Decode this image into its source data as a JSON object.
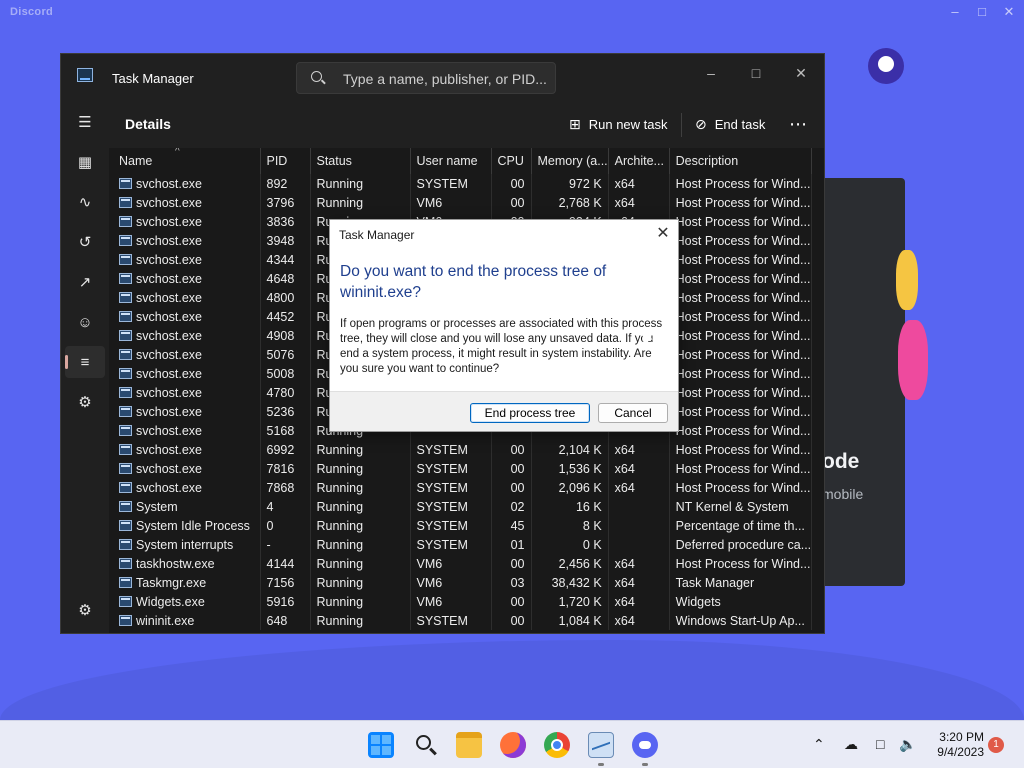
{
  "discord": {
    "title": "Discord",
    "card_title": "ode",
    "card_subtitle": "mobile"
  },
  "task_manager": {
    "title": "Task Manager",
    "search_placeholder": "Type a name, publisher, or PID...",
    "page_title": "Details",
    "run_new_task": "Run new task",
    "end_task": "End task",
    "more": "⋯",
    "sidebar": [
      {
        "name": "hamburger-menu-icon",
        "glyph": "☰"
      },
      {
        "name": "processes-icon",
        "glyph": "▦"
      },
      {
        "name": "performance-icon",
        "glyph": "∿"
      },
      {
        "name": "app-history-icon",
        "glyph": "↺"
      },
      {
        "name": "startup-apps-icon",
        "glyph": "↗"
      },
      {
        "name": "users-icon",
        "glyph": "☺"
      },
      {
        "name": "details-icon",
        "glyph": "≡"
      },
      {
        "name": "services-icon",
        "glyph": "⚙"
      }
    ],
    "settings_glyph": "⚙",
    "columns": [
      "Name",
      "PID",
      "Status",
      "User name",
      "CPU",
      "Memory (a...",
      "Archite...",
      "Description"
    ],
    "rows": [
      [
        "svchost.exe",
        "892",
        "Running",
        "SYSTEM",
        "00",
        "972 K",
        "x64",
        "Host Process for Wind..."
      ],
      [
        "svchost.exe",
        "3796",
        "Running",
        "VM6",
        "00",
        "2,768 K",
        "x64",
        "Host Process for Wind..."
      ],
      [
        "svchost.exe",
        "3836",
        "Running",
        "VM6",
        "00",
        "924 K",
        "x64",
        "Host Process for Wind..."
      ],
      [
        "svchost.exe",
        "3948",
        "Running",
        "",
        "",
        "",
        "",
        "Host Process for Wind..."
      ],
      [
        "svchost.exe",
        "4344",
        "Running",
        "",
        "",
        "",
        "",
        "Host Process for Wind..."
      ],
      [
        "svchost.exe",
        "4648",
        "Running",
        "",
        "",
        "",
        "",
        "Host Process for Wind..."
      ],
      [
        "svchost.exe",
        "4800",
        "Running",
        "",
        "",
        "",
        "",
        "Host Process for Wind..."
      ],
      [
        "svchost.exe",
        "4452",
        "Running",
        "",
        "",
        "",
        "",
        "Host Process for Wind..."
      ],
      [
        "svchost.exe",
        "4908",
        "Running",
        "",
        "",
        "",
        "",
        "Host Process for Wind..."
      ],
      [
        "svchost.exe",
        "5076",
        "Running",
        "",
        "",
        "",
        "",
        "Host Process for Wind..."
      ],
      [
        "svchost.exe",
        "5008",
        "Running",
        "",
        "",
        "",
        "",
        "Host Process for Wind..."
      ],
      [
        "svchost.exe",
        "4780",
        "Running",
        "",
        "",
        "",
        "",
        "Host Process for Wind..."
      ],
      [
        "svchost.exe",
        "5236",
        "Running",
        "",
        "",
        "",
        "",
        "Host Process for Wind..."
      ],
      [
        "svchost.exe",
        "5168",
        "Running",
        "",
        "",
        "",
        "",
        "Host Process for Wind..."
      ],
      [
        "svchost.exe",
        "6992",
        "Running",
        "SYSTEM",
        "00",
        "2,104 K",
        "x64",
        "Host Process for Wind..."
      ],
      [
        "svchost.exe",
        "7816",
        "Running",
        "SYSTEM",
        "00",
        "1,536 K",
        "x64",
        "Host Process for Wind..."
      ],
      [
        "svchost.exe",
        "7868",
        "Running",
        "SYSTEM",
        "00",
        "2,096 K",
        "x64",
        "Host Process for Wind..."
      ],
      [
        "System",
        "4",
        "Running",
        "SYSTEM",
        "02",
        "16 K",
        "",
        "NT Kernel & System"
      ],
      [
        "System Idle Process",
        "0",
        "Running",
        "SYSTEM",
        "45",
        "8 K",
        "",
        "Percentage of time th..."
      ],
      [
        "System interrupts",
        "-",
        "Running",
        "SYSTEM",
        "01",
        "0 K",
        "",
        "Deferred procedure ca..."
      ],
      [
        "taskhostw.exe",
        "4144",
        "Running",
        "VM6",
        "00",
        "2,456 K",
        "x64",
        "Host Process for Wind..."
      ],
      [
        "Taskmgr.exe",
        "7156",
        "Running",
        "VM6",
        "03",
        "38,432 K",
        "x64",
        "Task Manager"
      ],
      [
        "Widgets.exe",
        "5916",
        "Running",
        "VM6",
        "00",
        "1,720 K",
        "x64",
        "Widgets"
      ],
      [
        "wininit.exe",
        "648",
        "Running",
        "SYSTEM",
        "00",
        "1,084 K",
        "x64",
        "Windows Start-Up Ap..."
      ]
    ]
  },
  "dialog": {
    "title": "Task Manager",
    "heading": "Do you want to end the process tree of wininit.exe?",
    "body": "If open programs or processes are associated with this process tree, they will close and you will lose any unsaved data. If you end a system process, it might result in system instability. Are you sure you want to continue?",
    "primary_button": "End process tree",
    "cancel_button": "Cancel"
  },
  "taskbar": {
    "time": "3:20 PM",
    "date": "9/4/2023",
    "notification_count": "1",
    "apps": [
      "start-icon",
      "search-icon",
      "file-explorer-icon",
      "firefox-icon",
      "chrome-icon",
      "task-manager-icon",
      "discord-icon"
    ]
  },
  "colors": {
    "desktop": "#5865f2",
    "taskbar": "#e9ebf6",
    "dialog_heading": "#1f3f8e",
    "notification_badge": "#e05a48"
  }
}
